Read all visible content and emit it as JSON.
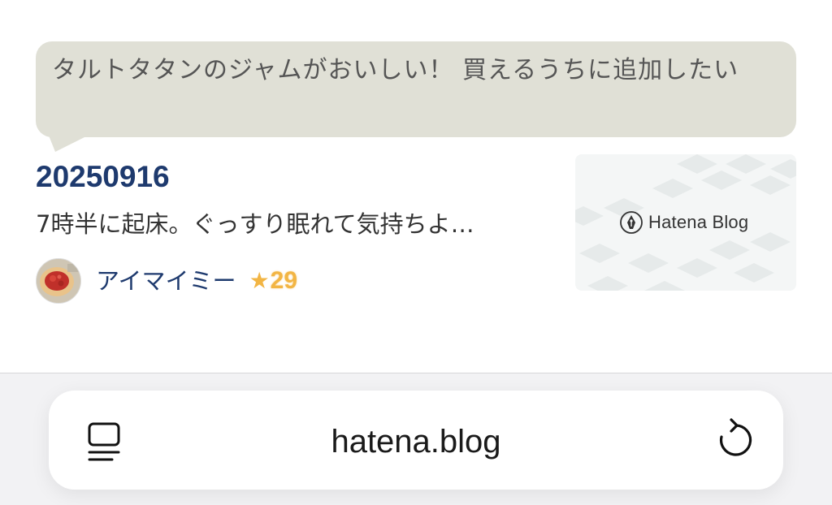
{
  "comment": {
    "text": "タルトタタンのジャムがおいしい！ 買えるうちに追加したい"
  },
  "entry": {
    "title": "20250916",
    "excerpt": "7時半に起床。ぐっすり眠れて気持ちよ…",
    "author": "アイマイミー",
    "star_icon": "★",
    "star_count": "29",
    "thumbnail_logo_text": "Hatena Blog"
  },
  "browser": {
    "url": "hatena.blog",
    "tabs_icon": "tab-overview-icon",
    "reload_icon": "reload-icon"
  },
  "colors": {
    "bubble": "#e0e0d6",
    "title": "#1e3a6e",
    "star": "#f2b544"
  }
}
